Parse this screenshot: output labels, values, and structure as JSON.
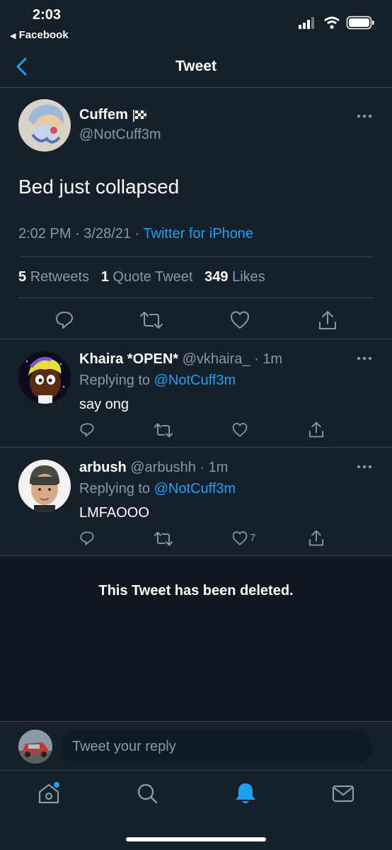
{
  "status_bar": {
    "time": "2:03",
    "back_app": "Facebook"
  },
  "nav": {
    "title": "Tweet"
  },
  "main_tweet": {
    "name": "Cuffem",
    "handle": "@NotCuff3m",
    "text": "Bed just collapsed",
    "time": "2:02 PM",
    "date": "3/28/21",
    "source": "Twitter for iPhone",
    "retweets_count": "5",
    "retweets_label": "Retweets",
    "quotes_count": "1",
    "quotes_label": "Quote Tweet",
    "likes_count": "349",
    "likes_label": "Likes"
  },
  "replies": [
    {
      "name": "Khaira *OPEN*",
      "handle": "@vkhaira_",
      "age": "1m",
      "replying_label": "Replying to",
      "replying_to": "@NotCuff3m",
      "text": "say ong",
      "like_count": ""
    },
    {
      "name": "arbush",
      "handle": "@arbushh",
      "age": "1m",
      "replying_label": "Replying to",
      "replying_to": "@NotCuff3m",
      "text": "LMFAOOO",
      "like_count": "7"
    }
  ],
  "deleted_notice": "This Tweet has been deleted.",
  "compose": {
    "placeholder": "Tweet your reply"
  },
  "tabbar": {
    "active_tab": "notifications",
    "icons": [
      "home-icon",
      "search-icon",
      "bell-icon",
      "mail-icon"
    ]
  },
  "colors": {
    "background": "#15202b",
    "accent": "#1da1f2",
    "muted": "#8899a6"
  }
}
